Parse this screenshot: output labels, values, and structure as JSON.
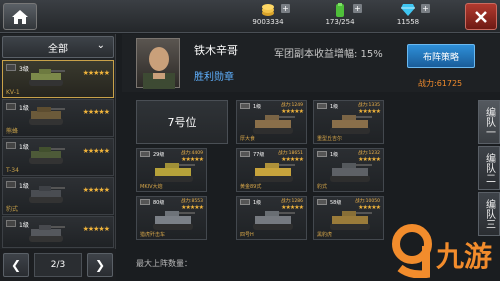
{
  "topbar": {
    "resources": [
      {
        "icon": "gold-coin-icon",
        "value": "9003334"
      },
      {
        "icon": "supply-icon",
        "value": "173/254"
      },
      {
        "icon": "diamond-icon",
        "value": "11558"
      }
    ]
  },
  "sidebar": {
    "filter_label": "全部",
    "tanks": [
      {
        "level": "3级",
        "stars": "★★★★★",
        "name": "KV-1",
        "selected": true
      },
      {
        "level": "1级",
        "stars": "★★★★★",
        "name": "熊蜂"
      },
      {
        "level": "1级",
        "stars": "★★★★★",
        "name": "T-34"
      },
      {
        "level": "1级",
        "stars": "★★★★★",
        "name": "豹式"
      },
      {
        "level": "1级",
        "stars": "★★★★★",
        "name": ""
      }
    ],
    "pager": {
      "current": "2/3",
      "prev": "❮",
      "next": "❯"
    }
  },
  "commander": {
    "name": "铁木辛哥",
    "badge": "胜利勋章",
    "bonus": "军团副本收益增幅: 15%",
    "strategy_button": "布阵策略",
    "power": "战力:61725"
  },
  "formation": {
    "slot_label": "7号位",
    "cards": [
      {
        "level": "1级",
        "power": "战力:1249",
        "stars": "★★★★★",
        "name": "厚大食"
      },
      {
        "level": "1级",
        "power": "战力:1335",
        "stars": "★★★★★",
        "name": "重型丘吉尔"
      },
      {
        "level": "29级",
        "power": "战力:4409",
        "stars": "★★★★★",
        "name": "MKIV大炮"
      },
      {
        "level": "77级",
        "power": "战力:18651",
        "stars": "★★★★★",
        "name": "黄金89式"
      },
      {
        "level": "1级",
        "power": "战力:1232",
        "stars": "★★★★★",
        "name": "豹式"
      },
      {
        "level": "80级",
        "power": "战力:8553",
        "stars": "★★★★★",
        "name": "猎虎歼击车"
      },
      {
        "level": "1级",
        "power": "战力:1286",
        "stars": "★★★★★",
        "name": "四号H"
      },
      {
        "level": "58级",
        "power": "战力:10050",
        "stars": "★★★★★",
        "name": "黑豹虎"
      }
    ],
    "max_label": "最大上阵数量："
  },
  "tabs": [
    {
      "label": "编队一"
    },
    {
      "label": "编队二"
    },
    {
      "label": "编队三"
    }
  ],
  "watermark": "九游",
  "colors": {
    "gold": "#f1b43b",
    "accent_blue": "#2e8fd8",
    "power_orange": "#f28c2c",
    "close_red": "#b23a2f"
  }
}
